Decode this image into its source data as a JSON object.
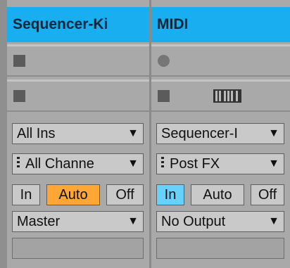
{
  "tracks": [
    {
      "name": "Sequencer-Ki",
      "input_type": "All Ins",
      "input_channel": "All Channe",
      "monitor": [
        "In",
        "Auto",
        "Off"
      ],
      "monitor_active": "Auto",
      "output": "Master"
    },
    {
      "name": "MIDI",
      "input_type": "Sequencer-I",
      "input_channel": "Post FX",
      "monitor": [
        "In",
        "Auto",
        "Off"
      ],
      "monitor_active": "In",
      "output": "No Output"
    }
  ],
  "icons": {
    "clip_stop": "square-icon",
    "clip_record": "circle-icon",
    "instrument": "piano-keys-icon",
    "dropdown": "chevron-down-icon",
    "drag": "grip-icon"
  },
  "colors": {
    "header": "#19aef0",
    "monitor_auto_active": "#ffa634",
    "monitor_in_active": "#68d2ff"
  }
}
